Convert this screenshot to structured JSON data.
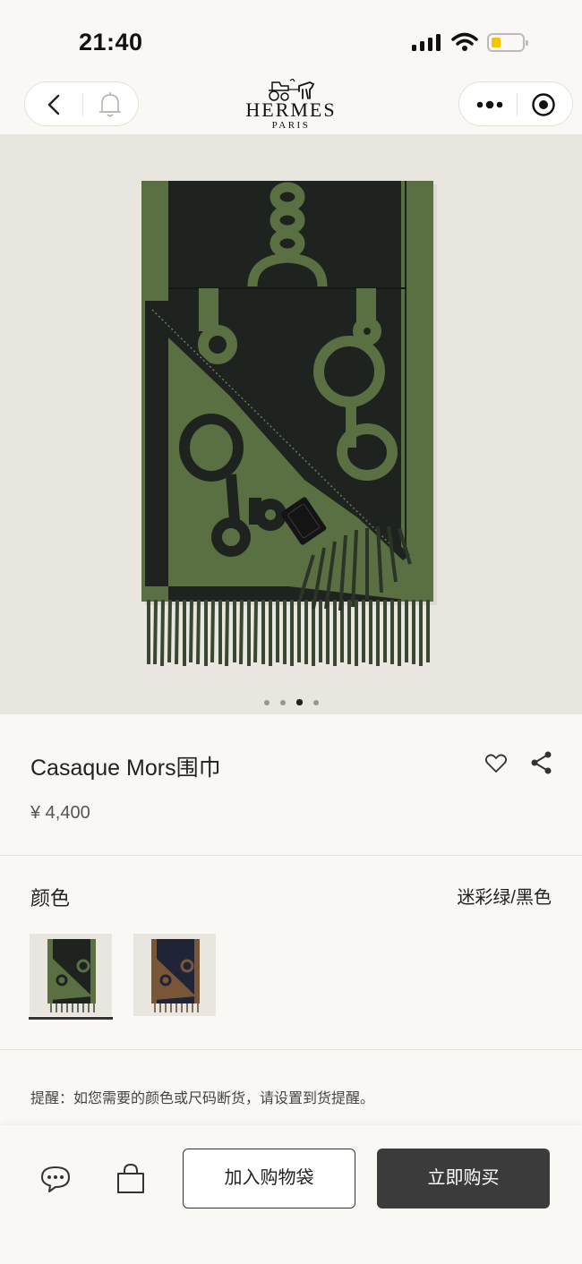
{
  "status_bar": {
    "time": "21:40"
  },
  "nav": {
    "brand_name": "HERMES",
    "brand_city": "PARIS"
  },
  "gallery": {
    "image_count": 4,
    "active_index": 3
  },
  "product": {
    "title": "Casaque Mors围巾",
    "price": "¥ 4,400"
  },
  "color": {
    "label": "颜色",
    "selected_value": "迷彩绿/黑色",
    "options": [
      {
        "name": "迷彩绿/黑色",
        "selected": true
      },
      {
        "name": "棕色/海军蓝",
        "selected": false
      }
    ]
  },
  "reminder": "提醒：如您需要的颜色或尺码断货，请设置到货提醒。",
  "bottom_bar": {
    "add_to_cart": "加入购物袋",
    "buy_now": "立即购买"
  },
  "colors": {
    "background": "#faf8f4",
    "scarf_green": "#5a7043",
    "scarf_black": "#1e2320",
    "button_dark": "#3b3b3b"
  }
}
